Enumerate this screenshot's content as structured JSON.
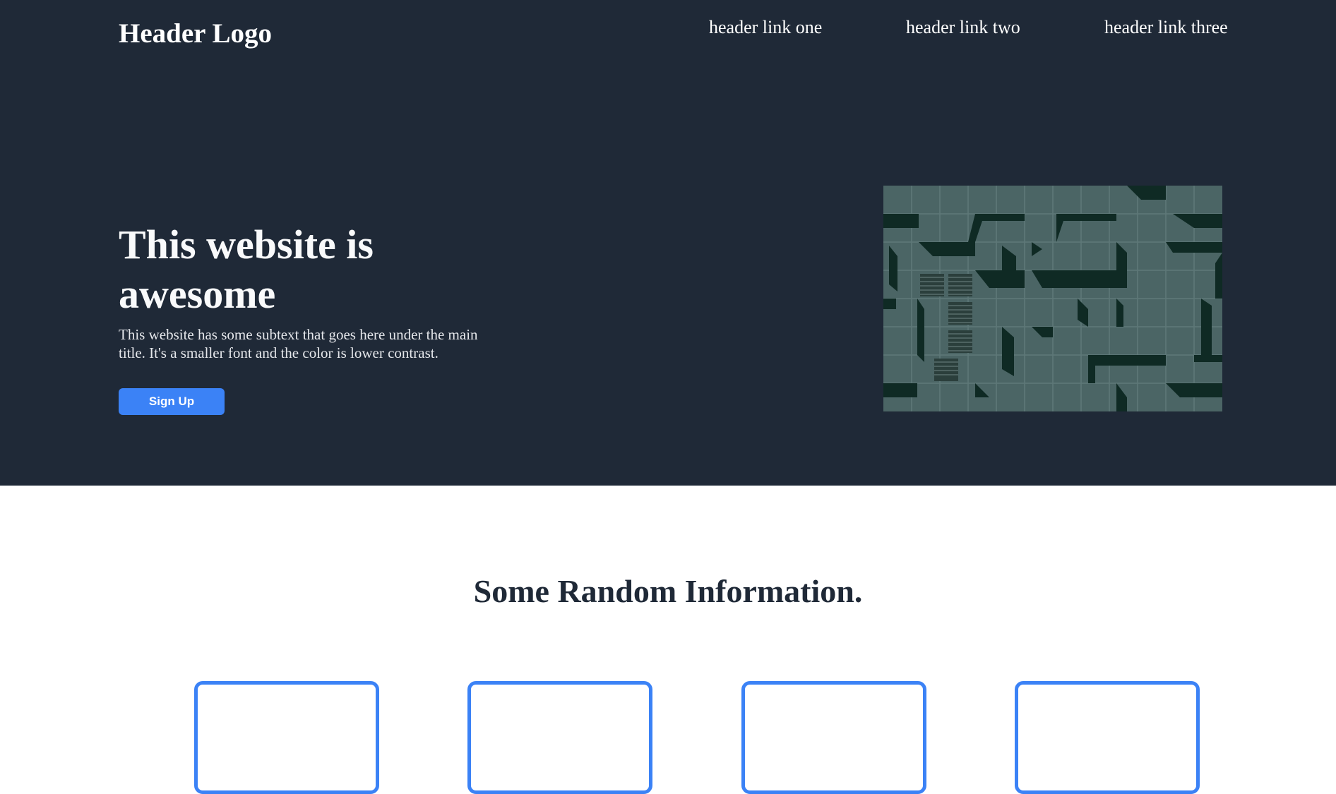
{
  "header": {
    "logo": "Header Logo",
    "links": [
      "header link one",
      "header link two",
      "header link three"
    ]
  },
  "hero": {
    "title": "This website is awesome",
    "subtext": "This website has some subtext that goes here under the main title. It's a smaller font and the color is lower contrast.",
    "cta_label": "Sign Up",
    "image_description_icon": "building-facade-image"
  },
  "info": {
    "title": "Some Random Information.",
    "card_count": 4
  },
  "colors": {
    "hero_background": "#1f2937",
    "accent": "#3b82f6",
    "page_background": "#ffffff"
  }
}
